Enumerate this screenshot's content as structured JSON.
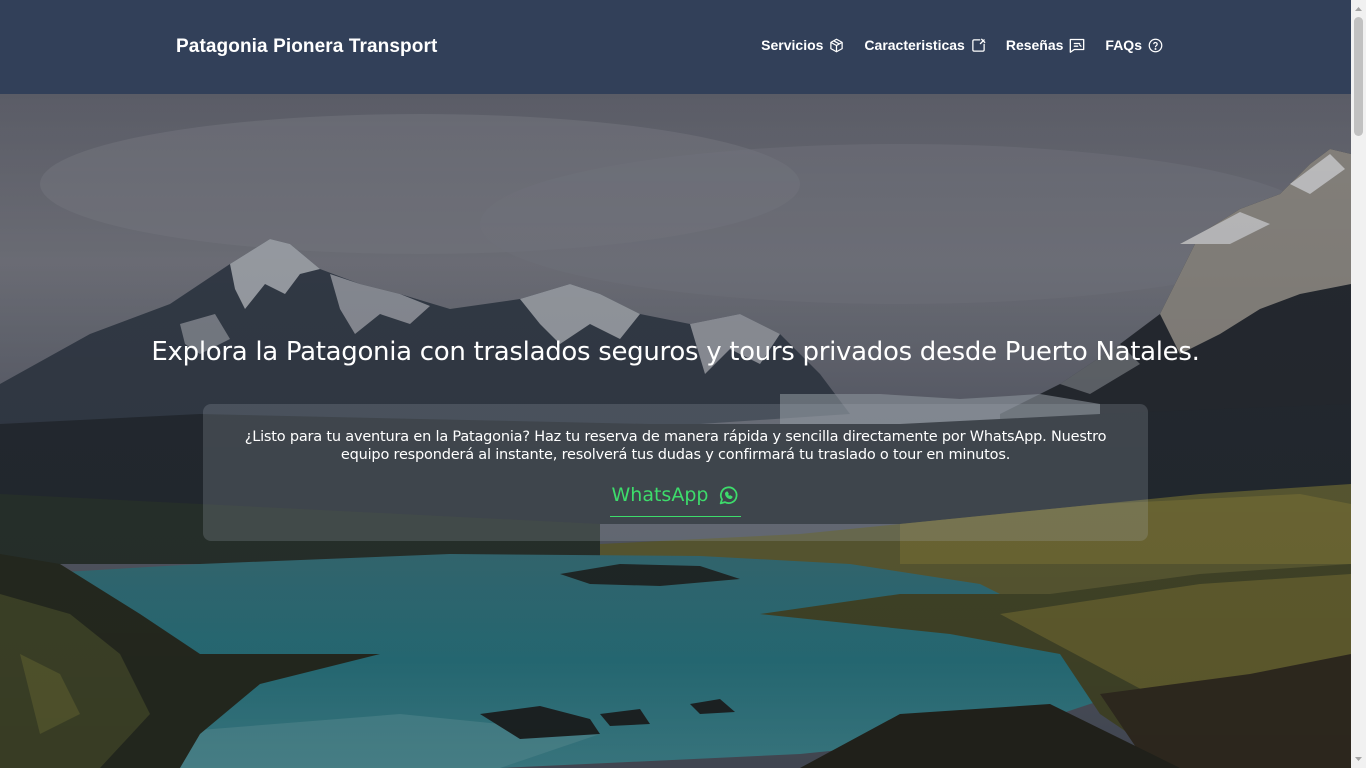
{
  "header": {
    "brand": "Patagonia Pionera Transport",
    "nav": [
      {
        "label": "Servicios",
        "icon": "box-icon"
      },
      {
        "label": "Caracteristicas",
        "icon": "edit-list-icon"
      },
      {
        "label": "Reseñas",
        "icon": "review-icon"
      },
      {
        "label": "FAQs",
        "icon": "question-icon"
      }
    ]
  },
  "hero": {
    "title": "Explora la Patagonia con traslados seguros y tours privados desde Puerto Natales.",
    "card_text": "¿Listo para tu aventura en la Patagonia? Haz tu reserva de manera rápida y sencilla directamente por WhatsApp. Nuestro equipo responderá al instante, resolverá tus dudas y confirmará tu traslado o tour en minutos.",
    "cta_label": "WhatsApp",
    "cta_icon": "whatsapp-icon"
  },
  "colors": {
    "header_bg": "#324059",
    "accent_green": "#3ddc6b",
    "text": "#ffffff"
  }
}
